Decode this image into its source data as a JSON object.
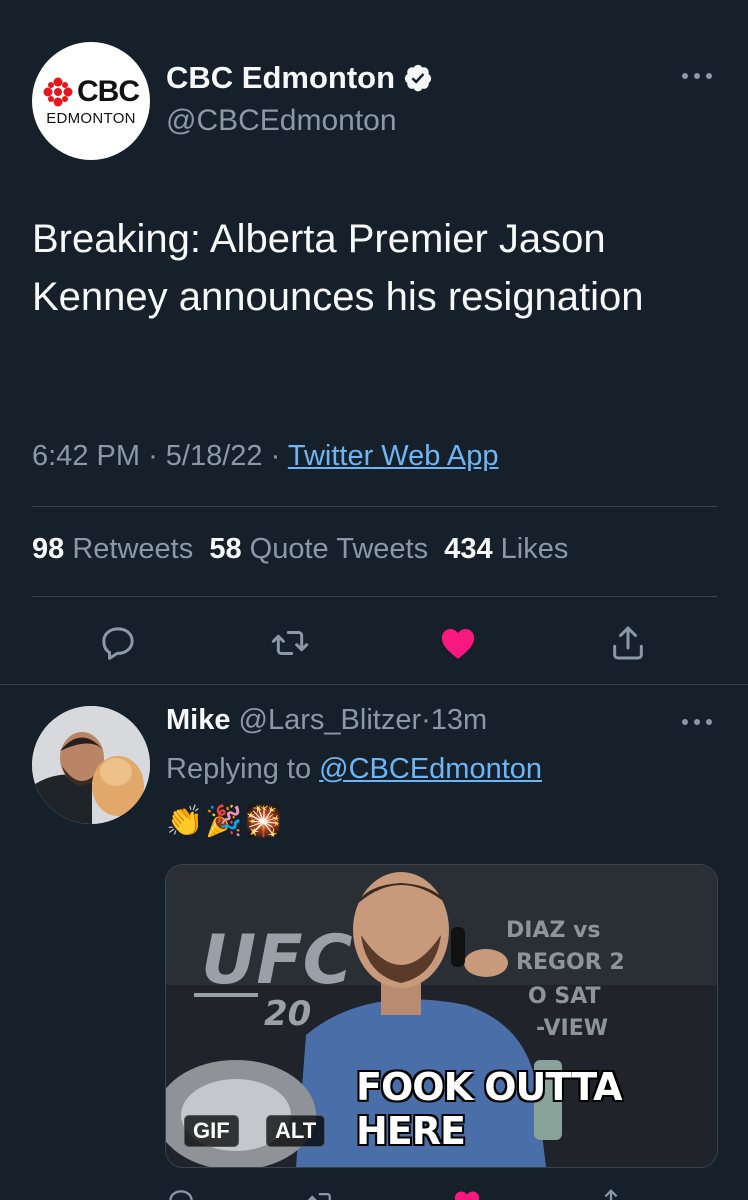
{
  "tweet": {
    "avatar_logo": "CBC",
    "avatar_logo_sub": "EDMONTON",
    "author_name": "CBC Edmonton",
    "author_handle": "@CBCEdmonton",
    "verified": true,
    "text": "Breaking: Alberta Premier Jason Kenney announces his resignation",
    "time": "6:42 PM",
    "date": "5/18/22",
    "source": "Twitter Web App",
    "separator": "·",
    "stats": {
      "retweets_count": "98",
      "retweets_label": "Retweets",
      "quotes_count": "58",
      "quotes_label": "Quote Tweets",
      "likes_count": "434",
      "likes_label": "Likes"
    },
    "actions": [
      "reply-icon",
      "retweet-icon",
      "like-icon",
      "share-icon"
    ],
    "liked": true
  },
  "reply": {
    "author_name": "Mike",
    "author_handle": "@Lars_Blitzer",
    "time_ago": "13m",
    "replying_prefix": "Replying to",
    "replying_handle": "@CBCEdmonton",
    "emojis": "👏🎉🎇",
    "media": {
      "caption": "FOOK OUTTA HERE",
      "badge_gif": "GIF",
      "badge_alt": "ALT",
      "backdrop_ufc": "UFC",
      "backdrop_ufc_sub": "20",
      "backdrop_right": [
        "DIAZ vs",
        "REGOR 2",
        "O SAT",
        "-VIEW"
      ]
    }
  },
  "colors": {
    "background": "#15202b",
    "text_primary": "#f7f9f9",
    "text_secondary": "#8b98a5",
    "link": "#6fb5f4",
    "divider": "#38444d",
    "like": "#f91880",
    "verified": "#f7f9f9"
  }
}
